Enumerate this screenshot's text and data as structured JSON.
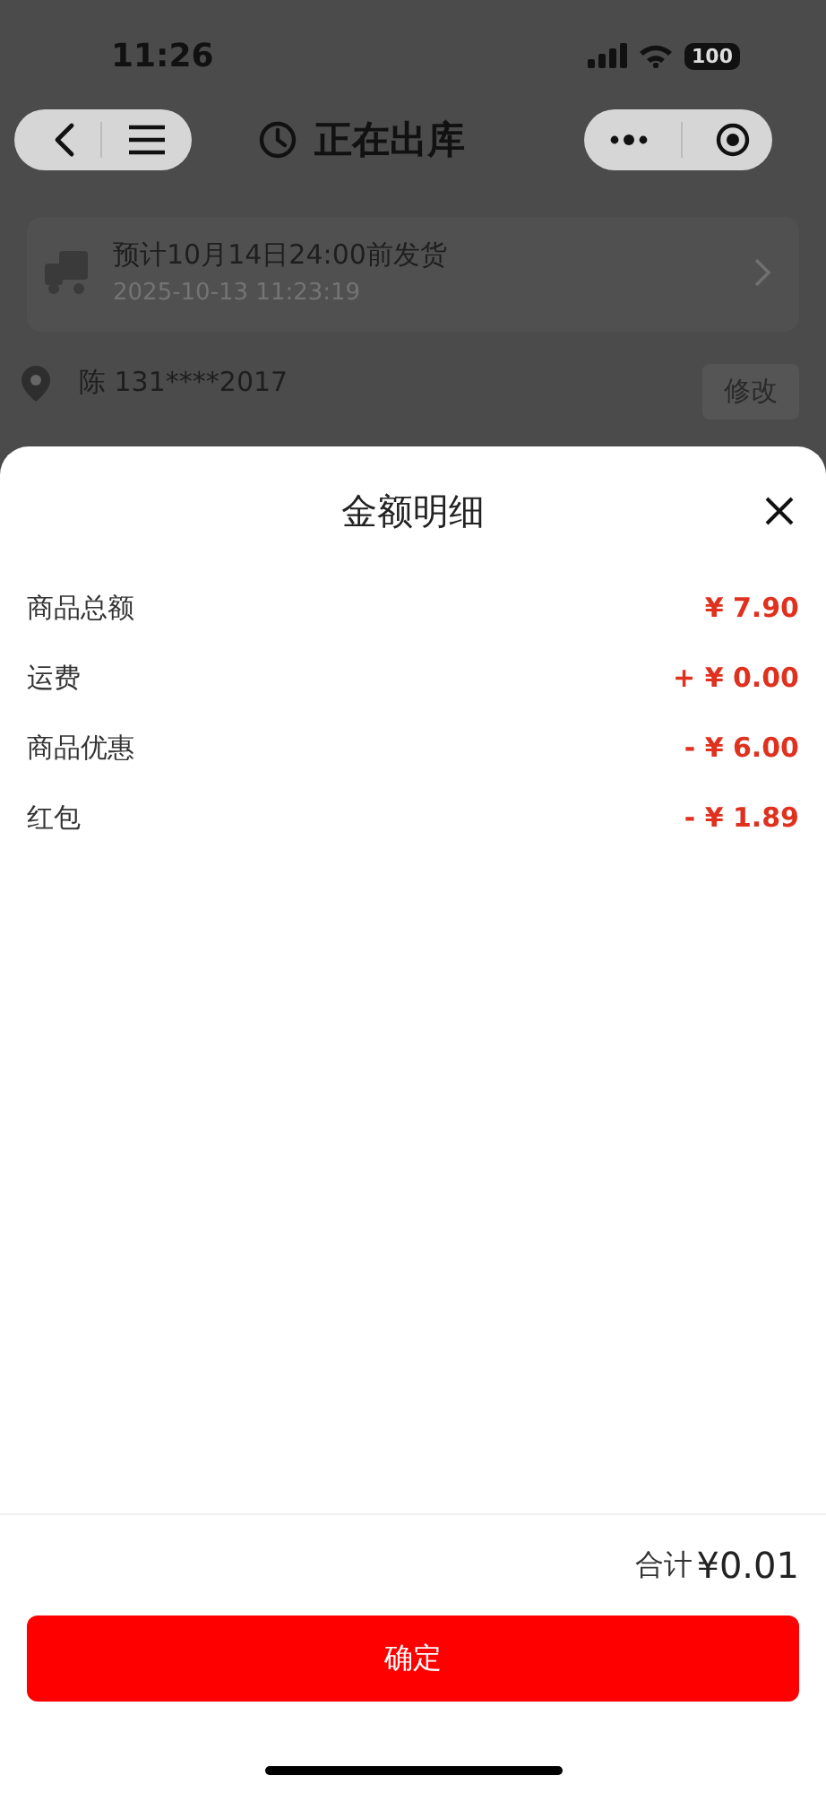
{
  "status_bar": {
    "time": "11:26",
    "battery": "100"
  },
  "nav": {
    "title": "正在出库"
  },
  "shipping": {
    "title": "预计10月14日24:00前发货",
    "time": "2025-10-13 11:23:19"
  },
  "address": {
    "contact": "陈 131****2017",
    "edit_button": "修改"
  },
  "sheet": {
    "title": "金额明细",
    "rows": [
      {
        "label": "商品总额",
        "amount": "¥ 7.90"
      },
      {
        "label": "运费",
        "amount": "+ ¥ 0.00"
      },
      {
        "label": "商品优惠",
        "amount": "- ¥ 6.00"
      },
      {
        "label": "红包",
        "amount": "- ¥ 1.89"
      }
    ],
    "total_label": "合计",
    "total": "¥0.01",
    "confirm_button": "确定"
  }
}
